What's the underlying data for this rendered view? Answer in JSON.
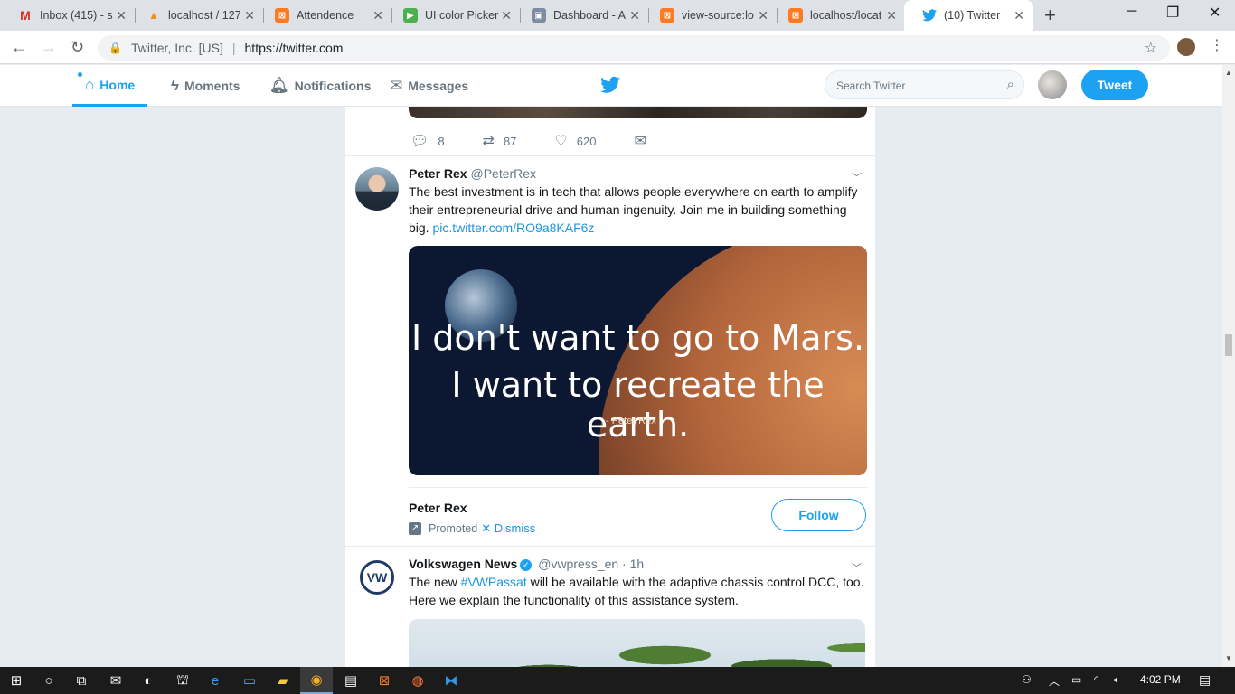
{
  "browser": {
    "tabs": [
      {
        "title": "Inbox (415) - s",
        "icon": "gmail-icon",
        "color": "#d93025",
        "glyph": "M"
      },
      {
        "title": "localhost / 127",
        "icon": "phpmyadmin-icon",
        "color": "#f29111",
        "glyph": "▲"
      },
      {
        "title": "Attendence",
        "icon": "xampp-icon",
        "color": "#fb7a24",
        "glyph": "⊠"
      },
      {
        "title": "UI color Picker",
        "icon": "colorpicker-icon",
        "color": "#4caf50",
        "glyph": "▶"
      },
      {
        "title": "Dashboard - A",
        "icon": "dashboard-icon",
        "color": "#7e8ba3",
        "glyph": "▣"
      },
      {
        "title": "view-source:lo",
        "icon": "xampp-icon",
        "color": "#fb7a24",
        "glyph": "⊠"
      },
      {
        "title": "localhost/locat",
        "icon": "xampp-icon",
        "color": "#fb7a24",
        "glyph": "⊠"
      },
      {
        "title": "(10) Twitter",
        "icon": "twitter-icon",
        "color": "#1da1f2",
        "glyph": "🐦"
      }
    ],
    "active_tab": 7,
    "url_org": "Twitter, Inc. [US]",
    "url": "https://twitter.com"
  },
  "twitter": {
    "nav": {
      "home": "Home",
      "moments": "Moments",
      "notifications": "Notifications",
      "messages": "Messages"
    },
    "search_placeholder": "Search Twitter",
    "tweet_button": "Tweet",
    "brand_color": "#1da1f2"
  },
  "timeline": {
    "prev_actions": {
      "replies": "8",
      "retweets": "87",
      "likes": "620"
    },
    "promoted_tweet": {
      "name": "Peter Rex",
      "handle": "@PeterRex",
      "text": "The best investment is in tech that allows people everywhere on earth to amplify their entrepreneurial drive and human ingenuity. Join me in building something big.",
      "link": "pic.twitter.com/RO9a8KAF6z",
      "image_line1": "I don't want to go to Mars.",
      "image_line2": "I want to recreate the earth.",
      "image_byline": "- Peter Rex",
      "follow_name": "Peter Rex",
      "promoted_label": "Promoted",
      "dismiss_label": "✕ Dismiss",
      "follow_button": "Follow"
    },
    "vw_tweet": {
      "name": "Volkswagen News",
      "handle": "@vwpress_en",
      "time": "· 1h",
      "text_before": "The new ",
      "hashtag": "#VWPassat",
      "text_after": " will be available with the adaptive chassis control DCC, too. Here we explain the functionality of this assistance system.",
      "avatar_text": "VW"
    }
  },
  "taskbar": {
    "time": "4:02 PM"
  }
}
